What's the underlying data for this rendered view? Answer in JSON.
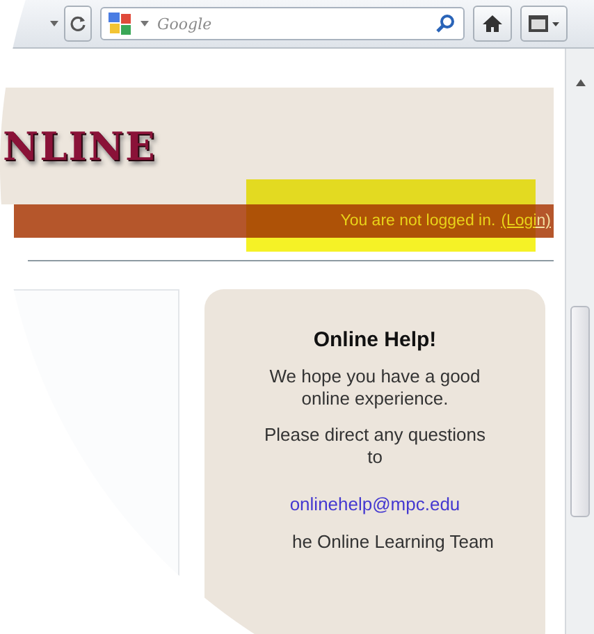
{
  "toolbar": {
    "search": {
      "placeholder": "Google"
    }
  },
  "header": {
    "logo": "NLINE",
    "login_status": "You are not logged in.",
    "login_link": "(Login)",
    "highlighted": true
  },
  "help": {
    "title": "Online Help!",
    "paragraphs": [
      "We hope you have a good online experience.",
      "Please direct any questions to"
    ],
    "email": "onlinehelp@mpc.edu",
    "signature": "he Online Learning Team"
  }
}
